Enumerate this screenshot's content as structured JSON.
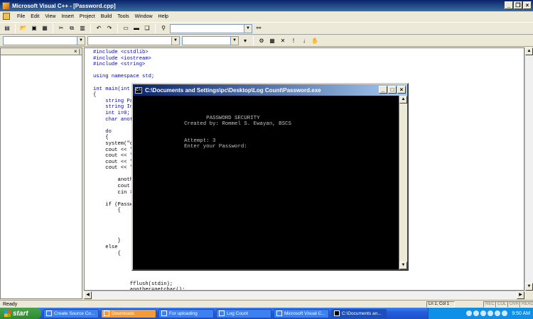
{
  "titlebar": {
    "title": "Microsoft Visual C++ - [Password.cpp]"
  },
  "menubar": [
    "File",
    "Edit",
    "View",
    "Insert",
    "Project",
    "Build",
    "Tools",
    "Window",
    "Help"
  ],
  "editor": {
    "lines": [
      "#include <cstdlib>",
      "#include <iostream>",
      "#include <string>",
      "",
      "using namespace std;",
      "",
      "int main(int argc, char *argv[])",
      "{",
      "    string Password = \"\";",
      "    string Input;",
      "    int i=0;",
      "    char another;",
      "",
      "    do",
      "    {",
      "    system(\"cls\");",
      "    cout << \"\";",
      "    cout << \"\";",
      "    cout << \"\";",
      "    cout << \"\";",
      "",
      "        another='n';",
      "        cout << \"\";",
      "        cin >> Input;",
      "",
      "    if (Password == Input)",
      "        {",
      "",
      "",
      "",
      "",
      "        }",
      "    else",
      "        {",
      "",
      "",
      "",
      "",
      "            fflush(stdin);",
      "            another=getchar();",
      "        }"
    ]
  },
  "console": {
    "title": "C:\\Documents and Settings\\pc\\Desktop\\Log Count\\Password.exe",
    "lines": [
      "                     PASSWORD SECURITY",
      "              Created by: Rommel S. Ewayan, BSCS",
      "",
      "",
      "              Attempt: 3",
      "              Enter your Password:"
    ]
  },
  "statusbar": {
    "left": "Ready",
    "position": "Ln 1, Col 1",
    "indicators": [
      "REC",
      "COL",
      "OVR",
      "READ"
    ]
  },
  "taskbar": {
    "start": "start",
    "tasks": [
      "Create Source Co...",
      "Downloads",
      "For uploading",
      "Log Count",
      "Microsoft Visual C...",
      "C:\\Documents an..."
    ],
    "clock": "9:50 AM"
  }
}
